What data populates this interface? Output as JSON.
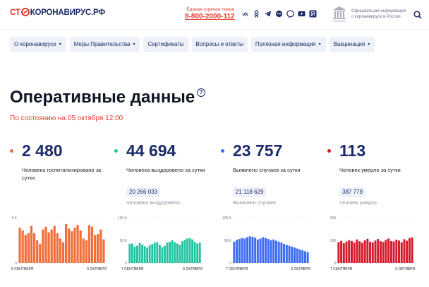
{
  "header": {
    "logo": {
      "part1": "СТ",
      "part2": "П",
      "part3": "КОРОНАВИРУС.РФ"
    },
    "hotline_label": "Единая горячая линия",
    "hotline_number": "8-800-2000-112",
    "socials": [
      "vk-icon",
      "ok-icon",
      "telegram-icon",
      "chat-icon",
      "viber-icon",
      "youtube-icon",
      "rutube-icon"
    ],
    "official_text": "Официальная информация о коронавирусе в России"
  },
  "nav": [
    {
      "label": "О коронавирусе",
      "dropdown": true
    },
    {
      "label": "Меры Правительства",
      "dropdown": true
    },
    {
      "label": "Сертификаты",
      "dropdown": false
    },
    {
      "label": "Вопросы и ответы",
      "dropdown": false
    },
    {
      "label": "Полезная информация",
      "dropdown": true
    },
    {
      "label": "Вакцинация",
      "dropdown": true
    }
  ],
  "page": {
    "title": "Оперативные данные",
    "subtitle": "По состоянию на 05 октября 12:00"
  },
  "stats": [
    {
      "value": "2 480",
      "desc": "Человека госпитализировано за сутки",
      "total": "",
      "total_label": "",
      "color": "#f0703c"
    },
    {
      "value": "44 694",
      "desc": "Человека выздоровело за сутки",
      "total": "20 266 033",
      "total_label": "Человека выздоровело",
      "color": "#1ec4a0"
    },
    {
      "value": "23 757",
      "desc": "Выявлено случаев за сутки",
      "total": "21 118 629",
      "total_label": "Выявлено случаев",
      "color": "#3c6df0"
    },
    {
      "value": "113",
      "desc": "Человек умерло за сутки",
      "total": "387 779",
      "total_label": "Человек умерло",
      "color": "#d41c2c"
    }
  ],
  "chart_data": [
    {
      "type": "bar",
      "color": "#f0703c",
      "ylim": [
        0,
        5000
      ],
      "ytick_labels": [
        "5 K",
        "0"
      ],
      "ytick_values": [
        5000,
        0
      ],
      "x_start": "6 СЕНТЯБРЯ",
      "x_end": "5 ОКТЯБРЯ",
      "values": [
        3900,
        3600,
        3100,
        3300,
        4100,
        3300,
        2500,
        2100,
        3700,
        4000,
        3400,
        3700,
        4100,
        3300,
        2700,
        2300,
        4300,
        3800,
        3500,
        3900,
        4200,
        3600,
        2700,
        2500,
        4200,
        4000,
        3100,
        3200,
        3700,
        2600
      ]
    },
    {
      "type": "bar",
      "color": "#1ec4a0",
      "ylim": [
        0,
        100000
      ],
      "ytick_labels": [
        "100 K",
        "50 K",
        "0"
      ],
      "ytick_values": [
        100000,
        50000,
        0
      ],
      "x_start": "7 СЕНТЯБРЯ",
      "x_end": "5 ОКТЯБРЯ",
      "values": [
        42000,
        43000,
        36000,
        38000,
        44000,
        41000,
        37000,
        34000,
        39000,
        42000,
        45000,
        46000,
        40000,
        35000,
        38000,
        45000,
        47000,
        50000,
        46000,
        43000,
        40000,
        48000,
        51000,
        54000,
        55000,
        52000,
        47000,
        43000,
        44694
      ]
    },
    {
      "type": "bar",
      "color": "#3c6df0",
      "ylim": [
        0,
        100000
      ],
      "ytick_labels": [
        "100 K",
        "50 K",
        "0"
      ],
      "ytick_values": [
        100000,
        50000,
        0
      ],
      "x_start": "7 СЕНТЯБРЯ",
      "x_end": "5 ОКТЯБРЯ",
      "values": [
        47000,
        51000,
        53000,
        55000,
        54000,
        57000,
        59000,
        58000,
        56000,
        52000,
        54000,
        57000,
        55000,
        53000,
        50000,
        52000,
        49000,
        47000,
        45000,
        42000,
        40000,
        38000,
        36000,
        34000,
        32000,
        30000,
        28000,
        26000,
        23757
      ]
    },
    {
      "type": "bar",
      "color": "#d41c2c",
      "ylim": [
        0,
        200
      ],
      "ytick_labels": [
        "200",
        "100",
        "0"
      ],
      "ytick_values": [
        200,
        100,
        0
      ],
      "x_start": "7 СЕНТЯБРЯ",
      "x_end": "5 ОКТЯБРЯ",
      "values": [
        92,
        98,
        87,
        95,
        101,
        97,
        90,
        104,
        96,
        89,
        100,
        107,
        94,
        91,
        99,
        106,
        96,
        93,
        102,
        108,
        97,
        95,
        103,
        99,
        92,
        105,
        98,
        110,
        113
      ]
    }
  ]
}
